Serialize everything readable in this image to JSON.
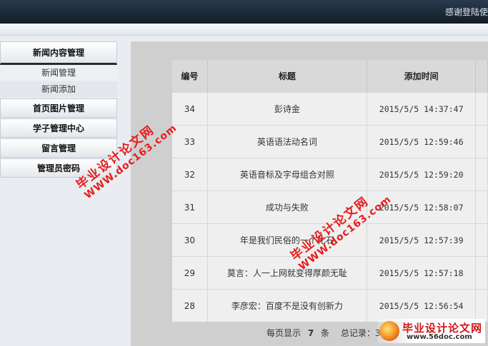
{
  "header": {
    "welcome": "感谢登陆使"
  },
  "sidebar": {
    "menus": [
      {
        "label": "新闻内容管理",
        "sub": [
          "新闻管理",
          "新闻添加"
        ]
      },
      {
        "label": "首页图片管理"
      },
      {
        "label": "学子管理中心"
      },
      {
        "label": "留言管理"
      },
      {
        "label": "管理员密码"
      }
    ]
  },
  "table": {
    "headers": [
      "编号",
      "标题",
      "添加时间"
    ],
    "rows": [
      {
        "id": "34",
        "title": "彭诗金",
        "time": "2015/5/5 14:37:47"
      },
      {
        "id": "33",
        "title": "英语语法动名词",
        "time": "2015/5/5 12:59:46"
      },
      {
        "id": "32",
        "title": "英语音标及字母组合对照",
        "time": "2015/5/5 12:59:20"
      },
      {
        "id": "31",
        "title": "成功与失败",
        "time": "2015/5/5 12:58:07"
      },
      {
        "id": "30",
        "title": "年是我们民俗的一个化石",
        "time": "2015/5/5 12:57:39"
      },
      {
        "id": "29",
        "title": "莫言：人一上网就变得厚颜无耻",
        "time": "2015/5/5 12:57:18"
      },
      {
        "id": "28",
        "title": "李彦宏：百度不是没有创新力",
        "time": "2015/5/5 12:56:54"
      }
    ]
  },
  "pager": {
    "per_page_prefix": "每页显示",
    "per_page": "7",
    "per_page_suffix": "条",
    "total_label": "总记录：3"
  },
  "watermark": {
    "cn": "毕业设计论文网",
    "url": "WWW.doc163.com"
  },
  "logo": {
    "name": "毕业设计论文网",
    "url": "www.56doc.com"
  },
  "colors": {
    "watermark": "#e61e1e",
    "header_bg": "#1b2838"
  }
}
